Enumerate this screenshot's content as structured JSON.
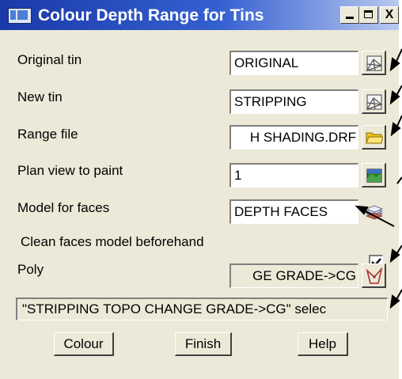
{
  "window": {
    "title": "Colour Depth Range for Tins",
    "minimize_icon": "minimize-icon",
    "maximize_icon": "maximize-icon",
    "close_label": "X"
  },
  "form": {
    "original_tin": {
      "label": "Original tin",
      "value": "ORIGINAL",
      "icon": "tin-pick-icon"
    },
    "new_tin": {
      "label": "New tin",
      "value": "STRIPPING",
      "icon": "tin-pick-icon"
    },
    "range_file": {
      "label": "Range file",
      "value": "H SHADING.DRF",
      "icon": "folder-icon"
    },
    "plan_view": {
      "label": "Plan view to paint",
      "value": "1",
      "icon": "view-icon"
    },
    "model_faces": {
      "label": "Model for faces",
      "value": "DEPTH FACES",
      "icon": "model-layers-icon"
    },
    "clean_faces": {
      "label": "Clean faces model beforehand",
      "checked": true
    },
    "poly": {
      "label": "Poly",
      "value": "GE GRADE->CG",
      "icon": "poly-pick-icon"
    }
  },
  "status": {
    "message": "\"STRIPPING TOPO CHANGE GRADE->CG\" selec"
  },
  "buttons": {
    "colour": "Colour",
    "finish": "Finish",
    "help": "Help"
  },
  "colors": {
    "titlebar_start": "#1a3aa8",
    "titlebar_end": "#b8c8f0",
    "dialog_bg": "#ece9d8"
  }
}
